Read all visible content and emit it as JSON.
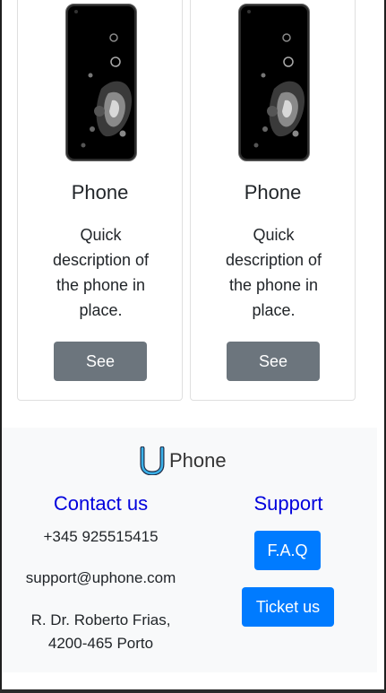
{
  "cards": [
    {
      "title": "Phone",
      "description": "Quick description of the phone in place.",
      "button_label": "See"
    },
    {
      "title": "Phone",
      "description": "Quick description of the phone in place.",
      "button_label": "See"
    }
  ],
  "footer": {
    "brand_letter": "U",
    "brand_name": "Phone",
    "contact": {
      "title": "Contact us",
      "phone": "+345 925515415",
      "email": "support@uphone.com",
      "address_line1": "R. Dr. Roberto Frias,",
      "address_line2": "4200-465 Porto"
    },
    "support": {
      "title": "Support",
      "faq_label": "F.A.Q",
      "ticket_label": "Ticket us"
    }
  },
  "colors": {
    "see_button": "#6c757d",
    "primary_button": "#007bff",
    "heading_blue": "#0000dd",
    "footer_bg": "#f8f9fa"
  }
}
